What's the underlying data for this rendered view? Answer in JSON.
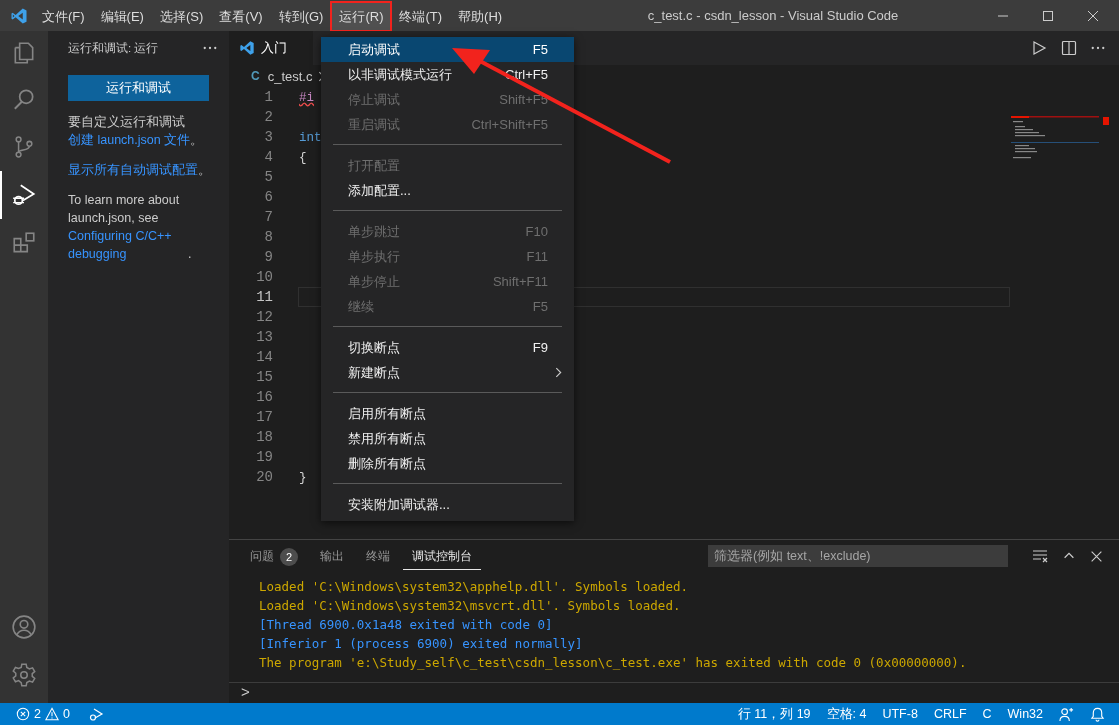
{
  "window": {
    "title": "c_test.c - csdn_lesson - Visual Studio Code"
  },
  "menu_bar": [
    {
      "label": "文件(F)",
      "selected": false
    },
    {
      "label": "编辑(E)",
      "selected": false
    },
    {
      "label": "选择(S)",
      "selected": false
    },
    {
      "label": "查看(V)",
      "selected": false
    },
    {
      "label": "转到(G)",
      "selected": false
    },
    {
      "label": "运行(R)",
      "selected": true
    },
    {
      "label": "终端(T)",
      "selected": false
    },
    {
      "label": "帮助(H)",
      "selected": false
    }
  ],
  "activity_bar": [
    {
      "kind": "explorer",
      "selected": false
    },
    {
      "kind": "search",
      "selected": false
    },
    {
      "kind": "source-control",
      "selected": false
    },
    {
      "kind": "run-debug",
      "selected": true
    },
    {
      "kind": "extensions",
      "selected": false
    }
  ],
  "activity_bar_bottom": [
    {
      "kind": "account",
      "selected": false
    },
    {
      "kind": "settings",
      "selected": false
    }
  ],
  "sidebar": {
    "title": "运行和调试: 运行",
    "button": "运行和调试",
    "paragraphs": [
      [
        {
          "text": "要自定义运行和调试",
          "link": false
        },
        {
          "text": "创建 launch.json 文件",
          "link": true
        },
        {
          "text": "。",
          "link": false
        }
      ],
      [
        {
          "text": "显示所有自动调试配置",
          "link": true
        },
        {
          "text": "。",
          "link": false
        }
      ],
      [
        {
          "text": "To learn more about launch.json, see ",
          "link": false
        },
        {
          "text": "Configuring C/C++ debugging",
          "link": true
        },
        {
          "text": ".",
          "link": false
        }
      ]
    ]
  },
  "editor_tabs": [
    {
      "label": "入门",
      "selected": true
    }
  ],
  "breadcrumb": {
    "file": "c_test.c",
    "icon_text": "C"
  },
  "code_lines": [
    {
      "number": "1",
      "text": "#i",
      "kind": "directive",
      "current": false
    },
    {
      "number": "2",
      "current": false
    },
    {
      "number": "3",
      "text": "int",
      "kind": "keyword",
      "current": false
    },
    {
      "number": "4",
      "text": "{",
      "kind": "plain",
      "current": false
    },
    {
      "number": "5",
      "current": false
    },
    {
      "number": "6",
      "current": false
    },
    {
      "number": "7",
      "current": false
    },
    {
      "number": "8",
      "current": false
    },
    {
      "number": "9",
      "current": false
    },
    {
      "number": "10",
      "current": false
    },
    {
      "number": "11",
      "current": true
    },
    {
      "number": "12",
      "current": false
    },
    {
      "number": "13",
      "current": false
    },
    {
      "number": "14",
      "current": false
    },
    {
      "number": "15",
      "current": false
    },
    {
      "number": "16",
      "current": false
    },
    {
      "number": "17",
      "current": false
    },
    {
      "number": "18",
      "current": false
    },
    {
      "number": "19",
      "current": false
    },
    {
      "number": "20",
      "text": "}",
      "kind": "plain",
      "current": false
    }
  ],
  "run_menu": [
    {
      "kind": "item",
      "label": "启动调试",
      "shortcut": "F5",
      "disabled": false,
      "selected": true
    },
    {
      "kind": "item",
      "label": "以非调试模式运行",
      "shortcut": "Ctrl+F5",
      "disabled": false,
      "selected": false
    },
    {
      "kind": "item",
      "label": "停止调试",
      "shortcut": "Shift+F5",
      "disabled": true,
      "selected": false
    },
    {
      "kind": "item",
      "label": "重启调试",
      "shortcut": "Ctrl+Shift+F5",
      "disabled": true,
      "selected": false
    },
    {
      "kind": "separator"
    },
    {
      "kind": "item",
      "label": "打开配置",
      "disabled": true,
      "selected": false
    },
    {
      "kind": "item",
      "label": "添加配置...",
      "disabled": false,
      "selected": false
    },
    {
      "kind": "separator"
    },
    {
      "kind": "item",
      "label": "单步跳过",
      "shortcut": "F10",
      "disabled": true,
      "selected": false
    },
    {
      "kind": "item",
      "label": "单步执行",
      "shortcut": "F11",
      "disabled": true,
      "selected": false
    },
    {
      "kind": "item",
      "label": "单步停止",
      "shortcut": "Shift+F11",
      "disabled": true,
      "selected": false
    },
    {
      "kind": "item",
      "label": "继续",
      "shortcut": "F5",
      "disabled": true,
      "selected": false
    },
    {
      "kind": "separator"
    },
    {
      "kind": "item",
      "label": "切换断点",
      "shortcut": "F9",
      "disabled": false,
      "selected": false
    },
    {
      "kind": "submenu",
      "label": "新建断点",
      "disabled": false,
      "selected": false
    },
    {
      "kind": "separator"
    },
    {
      "kind": "item",
      "label": "启用所有断点",
      "disabled": false,
      "selected": false
    },
    {
      "kind": "item",
      "label": "禁用所有断点",
      "disabled": false,
      "selected": false
    },
    {
      "kind": "item",
      "label": "删除所有断点",
      "disabled": false,
      "selected": false
    },
    {
      "kind": "separator"
    },
    {
      "kind": "item",
      "label": "安装附加调试器...",
      "disabled": false,
      "selected": false
    }
  ],
  "panel": {
    "tabs": [
      {
        "label": "问题",
        "badge": "2",
        "selected": false
      },
      {
        "label": "输出",
        "selected": false
      },
      {
        "label": "终端",
        "selected": false
      },
      {
        "label": "调试控制台",
        "selected": true
      }
    ],
    "filter": {
      "placeholder": "筛选器(例如 text、!exclude)"
    },
    "output": [
      {
        "text": "Loaded 'C:\\Windows\\system32\\apphelp.dll'. Symbols loaded.",
        "color": "#cca700"
      },
      {
        "text": "Loaded 'C:\\Windows\\system32\\msvcrt.dll'. Symbols loaded.",
        "color": "#cca700"
      },
      {
        "text": "[Thread 6900.0x1a48 exited with code 0]",
        "color": "#3794ff"
      },
      {
        "text": "[Inferior 1 (process 6900) exited normally]",
        "color": "#3794ff"
      },
      {
        "text": "The program 'e:\\Study_self\\c_test\\csdn_lesson\\c_test.exe' has exited with code 0 (0x00000000).",
        "color": "#cca700"
      }
    ],
    "prompt": ">"
  },
  "status_bar": {
    "errors": "2",
    "warnings": "0",
    "right": [
      "行 11，列 19",
      "空格: 4",
      "UTF-8",
      "CRLF",
      "C",
      "Win32"
    ]
  }
}
